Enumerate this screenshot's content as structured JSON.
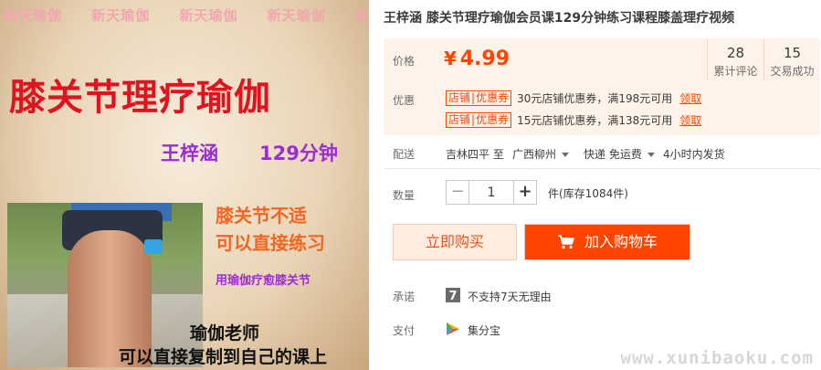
{
  "product_image": {
    "watermark_items": [
      "新天瑜伽",
      "新天瑜伽",
      "新天瑜伽",
      "新天瑜伽",
      "新天"
    ],
    "title": "膝关节理疗瑜伽",
    "teacher": "王梓涵",
    "duration": "129分钟",
    "line1": "膝关节不适",
    "line2": "可以直接练习",
    "line3": "用瑜伽疗愈膝关节",
    "line4": "瑜伽老师",
    "line5": "可以直接复制到自己的课上"
  },
  "product": {
    "title": "王梓涵 膝关节理疗瑜伽会员课129分钟练习课程膝盖理疗视频"
  },
  "price": {
    "label": "价格",
    "symbol": "¥",
    "value": "4.99"
  },
  "stats": [
    {
      "num": "28",
      "label": "累计评论"
    },
    {
      "num": "15",
      "label": "交易成功"
    }
  ],
  "promo": {
    "label": "优惠",
    "coupons": [
      {
        "tag_a": "店铺",
        "tag_b": "优惠券",
        "text": "30元店铺优惠券，满198元可用",
        "action": "领取"
      },
      {
        "tag_a": "店铺",
        "tag_b": "优惠券",
        "text": "15元店铺优惠券，满138元可用",
        "action": "领取"
      }
    ]
  },
  "delivery": {
    "label": "配送",
    "from": "吉林四平 至",
    "to": "广西柳州",
    "method": "快递 免运费",
    "dispatch": "4小时内发货"
  },
  "quantity": {
    "label": "数量",
    "minus": "−",
    "value": "1",
    "plus": "+",
    "stock": "件(库存1084件)"
  },
  "actions": {
    "buy_now": "立即购买",
    "add_cart": "加入购物车"
  },
  "promise": {
    "label": "承诺",
    "icon_glyph": "7",
    "text": "不支持7天无理由"
  },
  "payment": {
    "label": "支付",
    "text": "集分宝"
  },
  "site_watermark": "www.xunibaoku.com",
  "colors": {
    "accent": "#ff4400",
    "price_bg": "#fff2e8",
    "buy_now_bg": "#ffeedf"
  }
}
